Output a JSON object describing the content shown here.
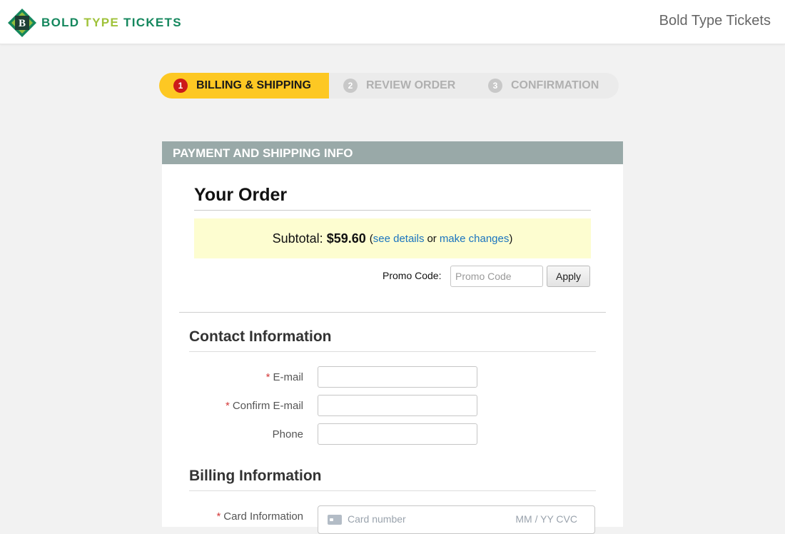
{
  "header": {
    "logo": {
      "mark_letter": "B",
      "word1": "BOLD",
      "word2": "TYPE",
      "word3": "TICKETS"
    },
    "site_name": "Bold Type Tickets"
  },
  "steps": [
    {
      "number": "1",
      "label": "BILLING & SHIPPING",
      "state": "active"
    },
    {
      "number": "2",
      "label": "REVIEW ORDER",
      "state": "inactive"
    },
    {
      "number": "3",
      "label": "CONFIRMATION",
      "state": "inactive"
    }
  ],
  "panel": {
    "title": "PAYMENT AND SHIPPING INFO"
  },
  "order": {
    "title": "Your Order",
    "subtotal_label": "Subtotal:",
    "subtotal_amount": "$59.60",
    "paren_open": "(",
    "see_details": "see details",
    "or": "or",
    "make_changes": "make changes",
    "paren_close": ")",
    "promo_label": "Promo Code:",
    "promo_placeholder": "Promo Code",
    "promo_value": "",
    "apply_label": "Apply"
  },
  "contact": {
    "title": "Contact Information",
    "fields": [
      {
        "label": "E-mail",
        "required": true,
        "value": ""
      },
      {
        "label": "Confirm E-mail",
        "required": true,
        "value": ""
      },
      {
        "label": "Phone",
        "required": false,
        "value": ""
      }
    ],
    "required_marker": "*"
  },
  "billing": {
    "title": "Billing Information",
    "card_label": "Card Information",
    "card_placeholder": "Card number",
    "card_placeholder_right": "MM / YY  CVC"
  },
  "colors": {
    "accent_yellow": "#fdc823",
    "panel_header": "#99a9a8",
    "link": "#1a74bf",
    "subtotal_bg": "#fdfdd0",
    "required": "#d43a3a",
    "logo_green": "#14875d",
    "logo_lime": "#9fc23a"
  }
}
